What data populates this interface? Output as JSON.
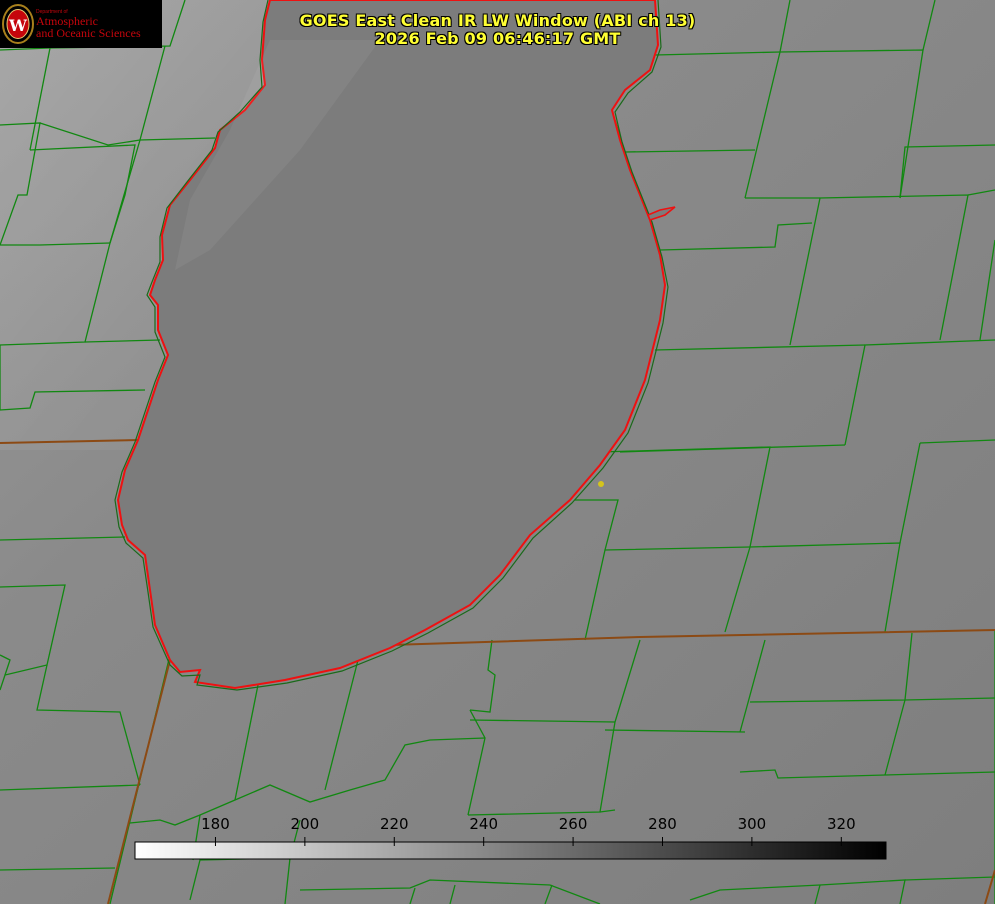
{
  "title": {
    "line1": "GOES East Clean IR LW Window (ABI ch 13)",
    "line2": "2026 Feb 09 06:46:17 GMT",
    "color": "#ffff33"
  },
  "logo": {
    "seal_letter": "W",
    "department_label": "Department of",
    "line1": "Atmospheric",
    "line2": "and Oceanic Sciences",
    "text_color": "#c5050c",
    "seal_color": "#a8801c"
  },
  "colorbar": {
    "ticks": [
      "180",
      "200",
      "220",
      "240",
      "260",
      "280",
      "300",
      "320"
    ],
    "tick_values": [
      180,
      200,
      220,
      240,
      260,
      280,
      300,
      320
    ],
    "range": [
      162,
      330
    ],
    "colormap": "white-to-black grayscale"
  },
  "colors": {
    "county_borders": "#118811",
    "state_borders": "#8c4a14",
    "lake_shoreline": "#ee1111",
    "land_background": "#828282",
    "lake_water": "#7c7c7c",
    "station_marker": "#d4c41c"
  }
}
